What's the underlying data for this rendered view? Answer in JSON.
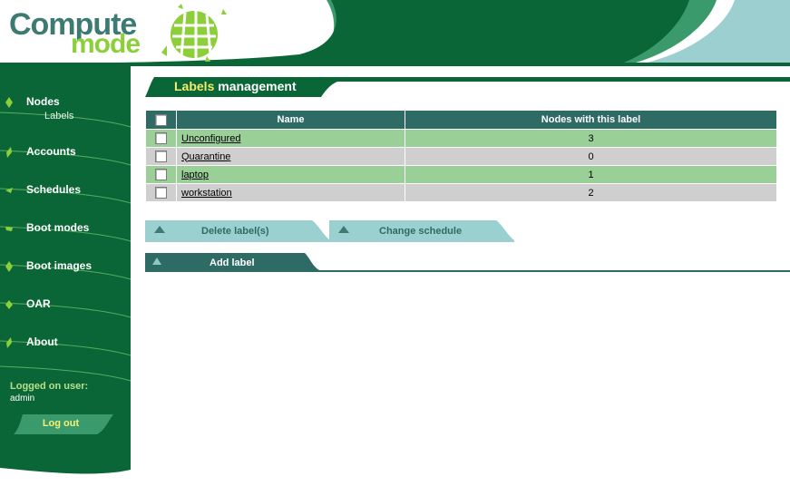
{
  "app": {
    "logo_line1": "Compute",
    "logo_line2": "mode"
  },
  "sidebar": {
    "items": [
      {
        "label": "Nodes",
        "sub": "Labels"
      },
      {
        "label": "Accounts"
      },
      {
        "label": "Schedules"
      },
      {
        "label": "Boot modes"
      },
      {
        "label": "Boot images"
      },
      {
        "label": "OAR"
      },
      {
        "label": "About"
      }
    ],
    "logged_label": "Logged on user:",
    "logged_user": "admin",
    "logout_label": "Log out"
  },
  "main": {
    "title_highlight": "Labels",
    "title_rest": " management",
    "table": {
      "headers": [
        "Name",
        "Nodes with this label"
      ],
      "rows": [
        {
          "name": "Unconfigured",
          "count": "3"
        },
        {
          "name": "Quarantine",
          "count": "0"
        },
        {
          "name": "laptop",
          "count": "1"
        },
        {
          "name": "workstation",
          "count": "2"
        }
      ]
    },
    "buttons": {
      "delete": "Delete label(s)",
      "change": "Change schedule",
      "add": "Add label"
    }
  },
  "colors": {
    "dark_green": "#0b6637",
    "teal": "#2f6b65",
    "row_green": "#9bcf98",
    "row_gray": "#cfcfcf",
    "button_light": "#9ad0d0",
    "logout_text": "#f6f17a"
  }
}
